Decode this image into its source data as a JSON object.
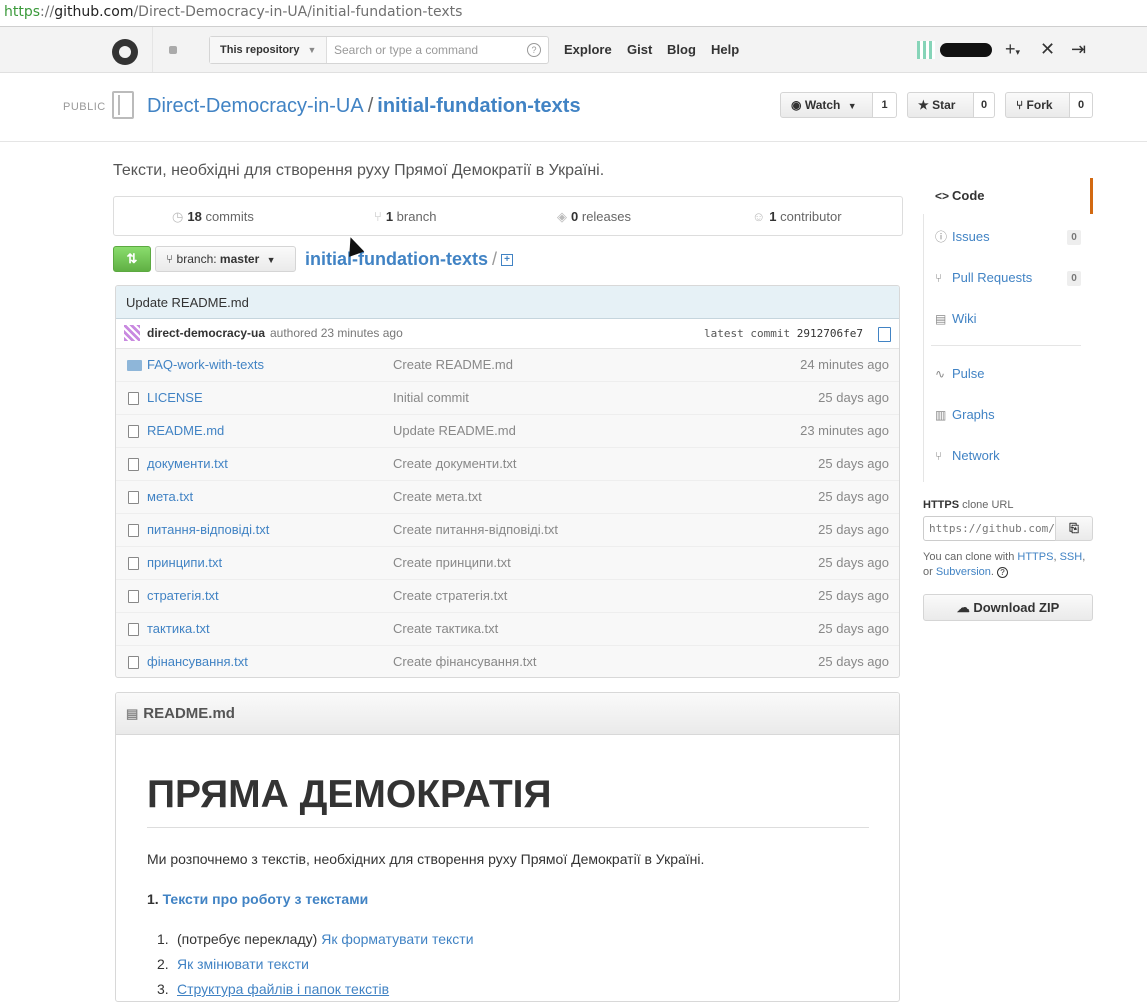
{
  "browser": {
    "url_scheme": "https",
    "url_sep": "://",
    "url_host": "github.com",
    "url_path": "/Direct-Democracy-in-UA/initial-fundation-texts"
  },
  "header": {
    "search_scope": "This repository",
    "search_placeholder": "Search or type a command",
    "search_help_icon": "?",
    "nav": [
      "Explore",
      "Gist",
      "Blog",
      "Help"
    ],
    "add_icon": "+",
    "tools_icon": "✕",
    "signout_icon": "⇥"
  },
  "repo": {
    "visibility": "PUBLIC",
    "owner": "Direct-Democracy-in-UA",
    "separator": "/",
    "name": "initial-fundation-texts",
    "watch_label": "Watch",
    "watch_count": "1",
    "star_label": "Star",
    "star_count": "0",
    "fork_label": "Fork",
    "fork_count": "0",
    "description": "Тексти, необхідні для створення руху Прямої Демократії в Україні."
  },
  "stats": {
    "commits_num": "18",
    "commits_label": "commits",
    "branches_num": "1",
    "branches_label": "branch",
    "releases_num": "0",
    "releases_label": "releases",
    "contributors_num": "1",
    "contributors_label": "contributor"
  },
  "branch": {
    "prefix": "branch:",
    "name": "master",
    "crumb": "initial-fundation-texts",
    "crumb_sep": "/"
  },
  "commit": {
    "message": "Update README.md",
    "author": "direct-democracy-ua",
    "authored": "authored 23 minutes ago",
    "latest_label": "latest commit",
    "sha": "2912706fe7"
  },
  "files": [
    {
      "name": "FAQ-work-with-texts",
      "type": "dir",
      "message": "Create README.md",
      "age": "24 minutes ago"
    },
    {
      "name": "LICENSE",
      "type": "file",
      "message": "Initial commit",
      "age": "25 days ago"
    },
    {
      "name": "README.md",
      "type": "file",
      "message": "Update README.md",
      "age": "23 minutes ago"
    },
    {
      "name": "документи.txt",
      "type": "file",
      "message": "Create документи.txt",
      "age": "25 days ago"
    },
    {
      "name": "мета.txt",
      "type": "file",
      "message": "Create мета.txt",
      "age": "25 days ago"
    },
    {
      "name": "питання-відповіді.txt",
      "type": "file",
      "message": "Create питання-відповіді.txt",
      "age": "25 days ago"
    },
    {
      "name": "принципи.txt",
      "type": "file",
      "message": "Create принципи.txt",
      "age": "25 days ago"
    },
    {
      "name": "стратегія.txt",
      "type": "file",
      "message": "Create стратегія.txt",
      "age": "25 days ago"
    },
    {
      "name": "тактика.txt",
      "type": "file",
      "message": "Create тактика.txt",
      "age": "25 days ago"
    },
    {
      "name": "фінансування.txt",
      "type": "file",
      "message": "Create фінансування.txt",
      "age": "25 days ago"
    }
  ],
  "readme": {
    "filename": "README.md",
    "h1": "ПРЯМА ДЕМОКРАТІЯ",
    "intro": "Ми розпочнемо з текстів, необхідних для створення руху Прямої Демократії в Україні.",
    "section_num": "1.",
    "section_link": "Тексти про роботу з текстами",
    "list": [
      {
        "num": "1.",
        "prefix": "(потребує перекладу) ",
        "link": "Як форматувати тексти"
      },
      {
        "num": "2.",
        "prefix": "",
        "link": "Як змінювати тексти"
      },
      {
        "num": "3.",
        "prefix": "",
        "link": "Структура файлів і папок текстів"
      }
    ]
  },
  "sidebar": {
    "code": "Code",
    "issues": "Issues",
    "issues_count": "0",
    "pulls": "Pull Requests",
    "pulls_count": "0",
    "wiki": "Wiki",
    "pulse": "Pulse",
    "graphs": "Graphs",
    "network": "Network",
    "clone_proto": "HTTPS",
    "clone_label": " clone URL",
    "clone_url": "https://github.com/Direct-Democracy-in-UA/initial-fundation-texts.git",
    "clone_help_1": "You can clone with ",
    "clone_https": "HTTPS",
    "clone_comma": ", ",
    "clone_ssh": "SSH",
    "clone_help_2": ", or ",
    "clone_svn": "Subversion",
    "clone_help_3": ".",
    "download_zip": "Download ZIP"
  }
}
